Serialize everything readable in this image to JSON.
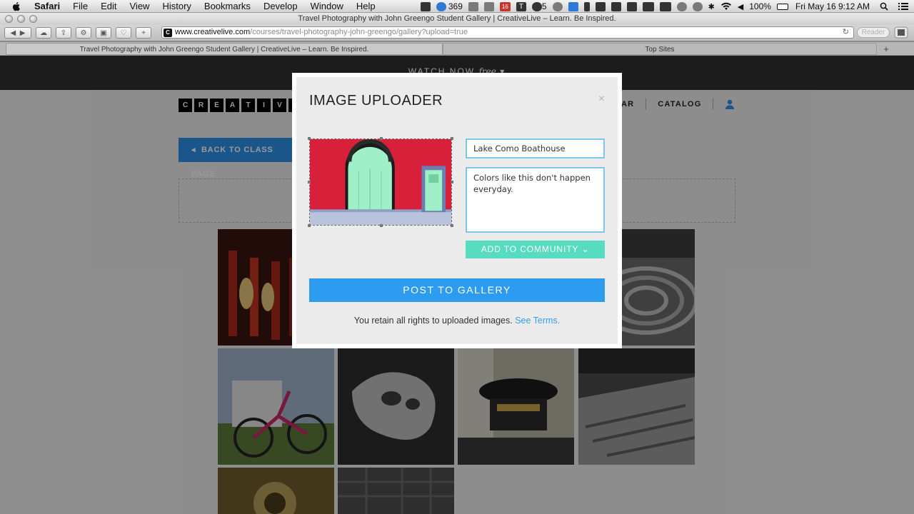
{
  "menubar": {
    "app": "Safari",
    "items": [
      "File",
      "Edit",
      "View",
      "History",
      "Bookmarks",
      "Develop",
      "Window",
      "Help"
    ],
    "status": {
      "badge_count": "369",
      "calendar_day": "16",
      "skype_count": "5",
      "battery": "100%",
      "datetime": "Fri May 16  9:12 AM"
    }
  },
  "window": {
    "title": "Travel Photography with John Greengo Student Gallery | CreativeLive – Learn. Be Inspired."
  },
  "toolbar": {
    "url_host": "www.creativelive.com",
    "url_path": "/courses/travel-photography-john-greengo/gallery?upload=true",
    "favicon_letter": "C",
    "reader_label": "Reader"
  },
  "tabs": [
    {
      "label": "Travel Photography with John Greengo Student Gallery | CreativeLive – Learn. Be Inspired."
    },
    {
      "label": "Top Sites"
    }
  ],
  "site": {
    "watch_label": "WATCH NOW",
    "watch_free": "free",
    "logo_letters": [
      "C",
      "R",
      "E",
      "A",
      "T",
      "I",
      "V",
      "E"
    ],
    "nav": {
      "partial_item": "AR",
      "catalog": "CATALOG"
    },
    "back_button": "BACK TO CLASS PAGE"
  },
  "modal": {
    "title": "IMAGE UPLOADER",
    "close": "×",
    "title_value": "Lake Como Boathouse",
    "caption_value": "Colors like this don't happen everyday.",
    "community_button": "ADD TO COMMUNITY",
    "post_button": "POST TO GALLERY",
    "rights_text": "You retain all rights to uploaded images.",
    "terms_link": "See Terms."
  },
  "colors": {
    "post_button": "#2d9bf0",
    "community_button": "#57dcc0",
    "field_border": "#7cc6ee",
    "back_button": "#2d8fe8",
    "link": "#3b9ce6"
  }
}
